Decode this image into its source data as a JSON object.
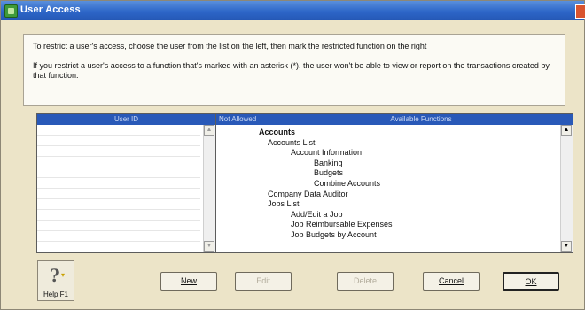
{
  "window": {
    "title": "User Access"
  },
  "info": {
    "line1": "To restrict a user's access, choose the user from the list on the left, then mark the restricted function on the right",
    "line2": "If you restrict a user's access to a function that's marked with an asterisk (*), the user won't be able to view or report on the transactions created by that function."
  },
  "user_list": {
    "header": "User ID"
  },
  "functions": {
    "header_not_allowed": "Not Allowed",
    "header_available": "Available Functions",
    "items": [
      {
        "label": "Accounts",
        "level": 0,
        "bold": true
      },
      {
        "label": "Accounts List",
        "level": 1,
        "bold": false
      },
      {
        "label": "Account Information",
        "level": 2,
        "bold": false
      },
      {
        "label": "Banking",
        "level": 3,
        "bold": false
      },
      {
        "label": "Budgets",
        "level": 3,
        "bold": false
      },
      {
        "label": "Combine Accounts",
        "level": 3,
        "bold": false
      },
      {
        "label": "Company Data Auditor",
        "level": 1,
        "bold": false
      },
      {
        "label": "Jobs List",
        "level": 1,
        "bold": false
      },
      {
        "label": "Add/Edit a Job",
        "level": 2,
        "bold": false
      },
      {
        "label": "Job Reimbursable Expenses",
        "level": 2,
        "bold": false
      },
      {
        "label": "Job Budgets by Account",
        "level": 2,
        "bold": false
      }
    ]
  },
  "buttons": {
    "help": "Help F1",
    "new": "New",
    "edit": "Edit",
    "delete": "Delete",
    "cancel": "Cancel",
    "ok": "OK"
  }
}
